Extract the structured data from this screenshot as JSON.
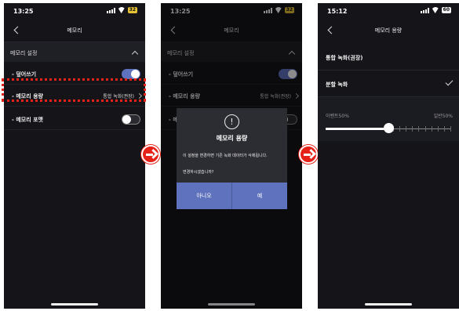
{
  "screens": [
    {
      "status": {
        "time": "13:25",
        "battery": "32"
      },
      "nav_title": "메모리",
      "section_title": "메모리 설정",
      "rows": [
        {
          "label": "- 덮어쓰기",
          "toggle": "on"
        },
        {
          "label": "- 메모리 용량",
          "value": "통합 녹화(권장)"
        },
        {
          "label": "- 메모리 포맷",
          "toggle": "off"
        }
      ]
    },
    {
      "status": {
        "time": "13:25",
        "battery": "32"
      },
      "nav_title": "메모리",
      "section_title": "메모리 설정",
      "rows": [
        {
          "label": "- 덮어쓰기",
          "toggle": "on"
        },
        {
          "label": "- 메모리 용량",
          "value": "통합 녹화(권장)"
        },
        {
          "label": "- 메"
        }
      ],
      "dialog": {
        "icon": "!",
        "title": "메모리 용량",
        "message": "이 설정을 변경하면 기존 녹화 데이터가 삭제됩니다.",
        "question": "변경하시겠습니까?",
        "cancel": "아니오",
        "confirm": "예"
      }
    },
    {
      "status": {
        "time": "15:12",
        "battery": "60"
      },
      "nav_title": "메모리 용량",
      "options": [
        {
          "label": "통합 녹화(권장)",
          "selected": false
        },
        {
          "label": "분할 녹화",
          "selected": true
        }
      ],
      "slider": {
        "left_label": "이벤트50%",
        "right_label": "일반50%",
        "value_percent": 50
      }
    }
  ],
  "colors": {
    "accent": "#5f72bd",
    "highlight": "#e62117",
    "background": "#141419"
  },
  "icons": {
    "next": "arrow-right-icon",
    "back": "chevron-left-icon"
  }
}
